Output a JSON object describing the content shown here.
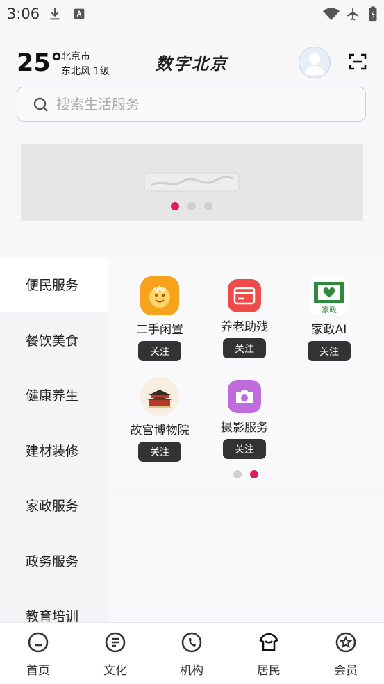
{
  "status_bar": {
    "time": "3:06"
  },
  "weather": {
    "temperature": "25°",
    "city": "北京市",
    "wind": "东北风 1级"
  },
  "app_brand": "数字北京",
  "search": {
    "placeholder": "搜索生活服务"
  },
  "banner": {
    "pages": 3,
    "active_page": 1
  },
  "sidebar": {
    "items": [
      {
        "label": "便民服务",
        "active": true
      },
      {
        "label": "餐饮美食"
      },
      {
        "label": "健康养生"
      },
      {
        "label": "建材装修"
      },
      {
        "label": "家政服务"
      },
      {
        "label": "政务服务"
      },
      {
        "label": "教育培训"
      }
    ]
  },
  "services": {
    "follow_label": "关注",
    "items": [
      {
        "name": "二手闲置",
        "icon": "secondhand-icon",
        "color": "#f7a21b"
      },
      {
        "name": "养老助残",
        "icon": "card-icon",
        "color": "#ef4b4b"
      },
      {
        "name": "家政AI",
        "icon": "housekeeping-icon",
        "color": "#2e8b3e"
      },
      {
        "name": "故宫博物院",
        "icon": "palace-icon",
        "color": "#b23a2a"
      },
      {
        "name": "摄影服务",
        "icon": "camera-icon",
        "color": "#c06bdc"
      }
    ],
    "pages": 2,
    "active_page": 2
  },
  "tabbar": {
    "items": [
      {
        "label": "首页",
        "icon": "home-icon"
      },
      {
        "label": "文化",
        "icon": "culture-icon"
      },
      {
        "label": "机构",
        "icon": "organization-icon"
      },
      {
        "label": "居民",
        "icon": "resident-icon",
        "active": true
      },
      {
        "label": "会员",
        "icon": "member-icon"
      }
    ]
  }
}
